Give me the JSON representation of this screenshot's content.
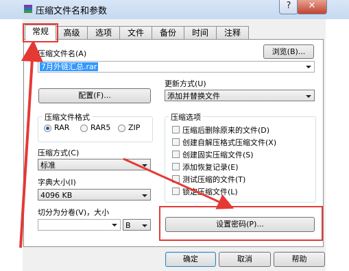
{
  "window": {
    "title": "压缩文件名和参数",
    "help_glyph": "?",
    "close_glyph": "✕"
  },
  "tabs": [
    {
      "label": "常规"
    },
    {
      "label": "高级"
    },
    {
      "label": "选项"
    },
    {
      "label": "文件"
    },
    {
      "label": "备份"
    },
    {
      "label": "时间"
    },
    {
      "label": "注释"
    }
  ],
  "archive": {
    "name_label": "压缩文件名(A)",
    "browse_button": "浏览(B)...",
    "filename": "7月外链汇总.rar"
  },
  "profiles_button": "配置(F)...",
  "update_mode": {
    "label": "更新方式(U)",
    "value": "添加并替换文件"
  },
  "format": {
    "title": "压缩文件格式",
    "options": [
      "RAR",
      "RAR5",
      "ZIP"
    ],
    "selected": "RAR"
  },
  "compression_method": {
    "label": "压缩方式(C)",
    "value": "标准"
  },
  "dictionary": {
    "label": "字典大小(I)",
    "value": "4096 KB"
  },
  "split": {
    "label": "切分为分卷(V)，大小",
    "unit": "B"
  },
  "options": {
    "title": "压缩选项",
    "items": [
      "压缩后删除原来的文件(D)",
      "创建自解压格式压缩文件(X)",
      "创建固实压缩文件(S)",
      "添加恢复记录(E)",
      "测试压缩的文件(T)",
      "锁定压缩文件(L)"
    ]
  },
  "set_password_button": "设置密码(P)...",
  "footer": {
    "ok": "确定",
    "cancel": "取消",
    "help": "帮助"
  },
  "colors": {
    "highlight": "#e53935",
    "title_bar": "#c5d9f1",
    "selection": "#3399ff"
  }
}
